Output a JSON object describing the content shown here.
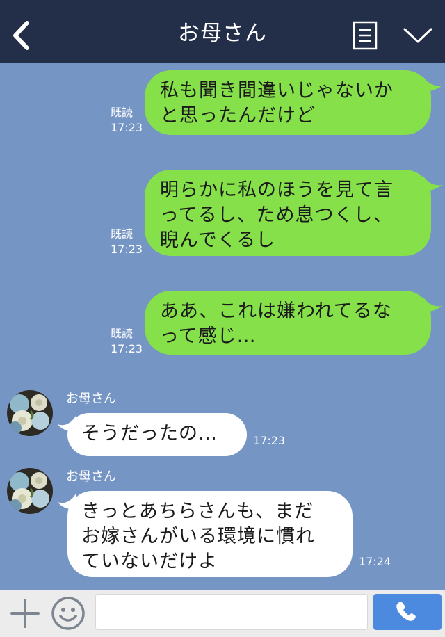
{
  "header": {
    "title": "お母さん"
  },
  "messages": {
    "sent1": {
      "lines": [
        "私も聞き間違いじゃないか",
        "と思ったんだけど"
      ],
      "read": "既読",
      "time": "17:23"
    },
    "sent2": {
      "lines": [
        "明らかに私のほうを見て言",
        "ってるし、ため息つくし、",
        "睨んでくるし"
      ],
      "read": "既読",
      "time": "17:23"
    },
    "sent3": {
      "lines": [
        "ああ、これは嫌われてるな",
        "って感じ…"
      ],
      "read": "既読",
      "time": "17:23"
    },
    "recv1": {
      "sender": "お母さん",
      "lines": [
        "そうだったの…"
      ],
      "time": "17:23"
    },
    "recv2": {
      "sender": "お母さん",
      "lines": [
        "きっとあちらさんも、まだ",
        "お嫁さんがいる環境に慣れ",
        "ていないだけよ"
      ],
      "time": "17:24"
    }
  },
  "input": {
    "placeholder": ""
  },
  "icons": {
    "back": "chevron-left-icon",
    "menu": "menu-list-icon",
    "collapse": "chevron-down-icon",
    "plus": "plus-icon",
    "emoji": "smiley-icon",
    "call": "phone-icon"
  },
  "colors": {
    "header_bg": "#232e49",
    "chat_bg": "#7595c5",
    "sent_bubble": "#86e04a",
    "received_bubble": "#ffffff",
    "call_button": "#4c8ae0"
  }
}
